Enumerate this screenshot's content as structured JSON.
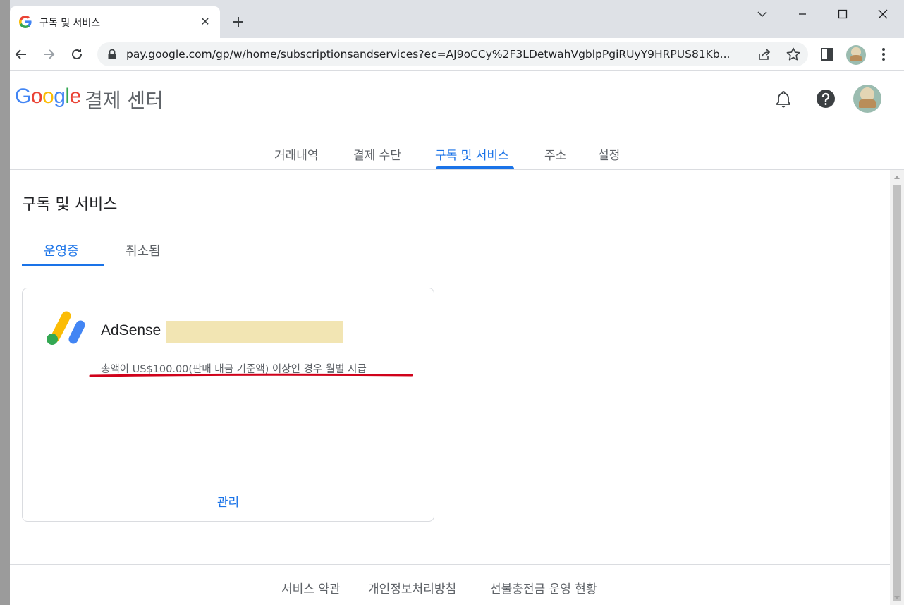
{
  "browser": {
    "tab_title": "구독 및 서비스",
    "url": "pay.google.com/gp/w/home/subscriptionsandservices?ec=AJ9oCCy%2F3LDetwahVgblpPgiRUyY9HRPUS81Kb..."
  },
  "header": {
    "logo": "Google",
    "center_title": "결제 센터",
    "nav": [
      "거래내역",
      "결제 수단",
      "구독 및 서비스",
      "주소",
      "설정"
    ],
    "active_nav": "구독 및 서비스"
  },
  "main": {
    "title": "구독 및 서비스",
    "subtabs": [
      "운영중",
      "취소됨"
    ],
    "active_subtab": "운영중",
    "card": {
      "title": "AdSense",
      "description": "총액이 US$100.00(판매 대금 기준액) 이상인 경우 월별 지급",
      "action": "관리"
    }
  },
  "footer": {
    "links": [
      "서비스 약관",
      "개인정보처리방침",
      "선불충전금 운영 현황"
    ]
  },
  "colors": {
    "accent": "#1a73e8",
    "annotation": "#d0021b"
  }
}
